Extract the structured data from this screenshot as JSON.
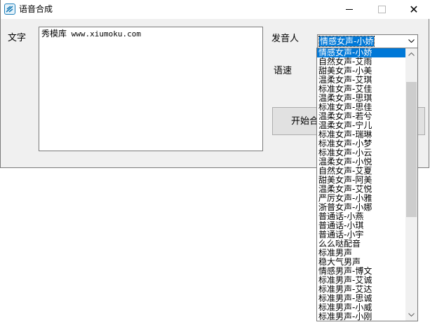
{
  "window": {
    "title": "语音合成",
    "icon": "app-logo-icon",
    "controls": {
      "minimize": "minimize-icon",
      "maximize": "maximize-icon",
      "close": "✕"
    }
  },
  "form": {
    "text_label": "文字",
    "text_value_cjk": "秀模库",
    "text_value_url": " www.xiumoku.com",
    "speaker_label": "发音人",
    "speaker_selected": "情感女声-小娇",
    "rate_label": "语速",
    "start_button": "开始合"
  },
  "speaker_options": [
    "情感女声-小娇",
    "自然女声-艾雨",
    "甜美女声-小美",
    "温柔女声-艾琪",
    "标准女声-艾佳",
    "温柔女声-思琪",
    "标准女声-思佳",
    "温柔女声-若兮",
    "温柔女声-宁儿",
    "标准女声-瑞琳",
    "标准女声-小梦",
    "标准女声-小云",
    "温柔女声-小悦",
    "自然女声-艾夏",
    "甜美女声-阿美",
    "温柔女声-艾悦",
    "严厉女声-小雅",
    "浙普女声-小娜",
    "普通话-小燕",
    "普通话-小琪",
    "普通话-小宇",
    "么么哒配音",
    "标准男声",
    "稳大气男声",
    "情感男声-博文",
    "标准男声-艾诚",
    "标准男声-艾达",
    "标准男声-思诚",
    "标准男声-小威",
    "标准男声-小刚"
  ],
  "colors": {
    "selection": "#0078d7",
    "window_bg": "#f0f0f0",
    "border": "#7a7a7a"
  }
}
